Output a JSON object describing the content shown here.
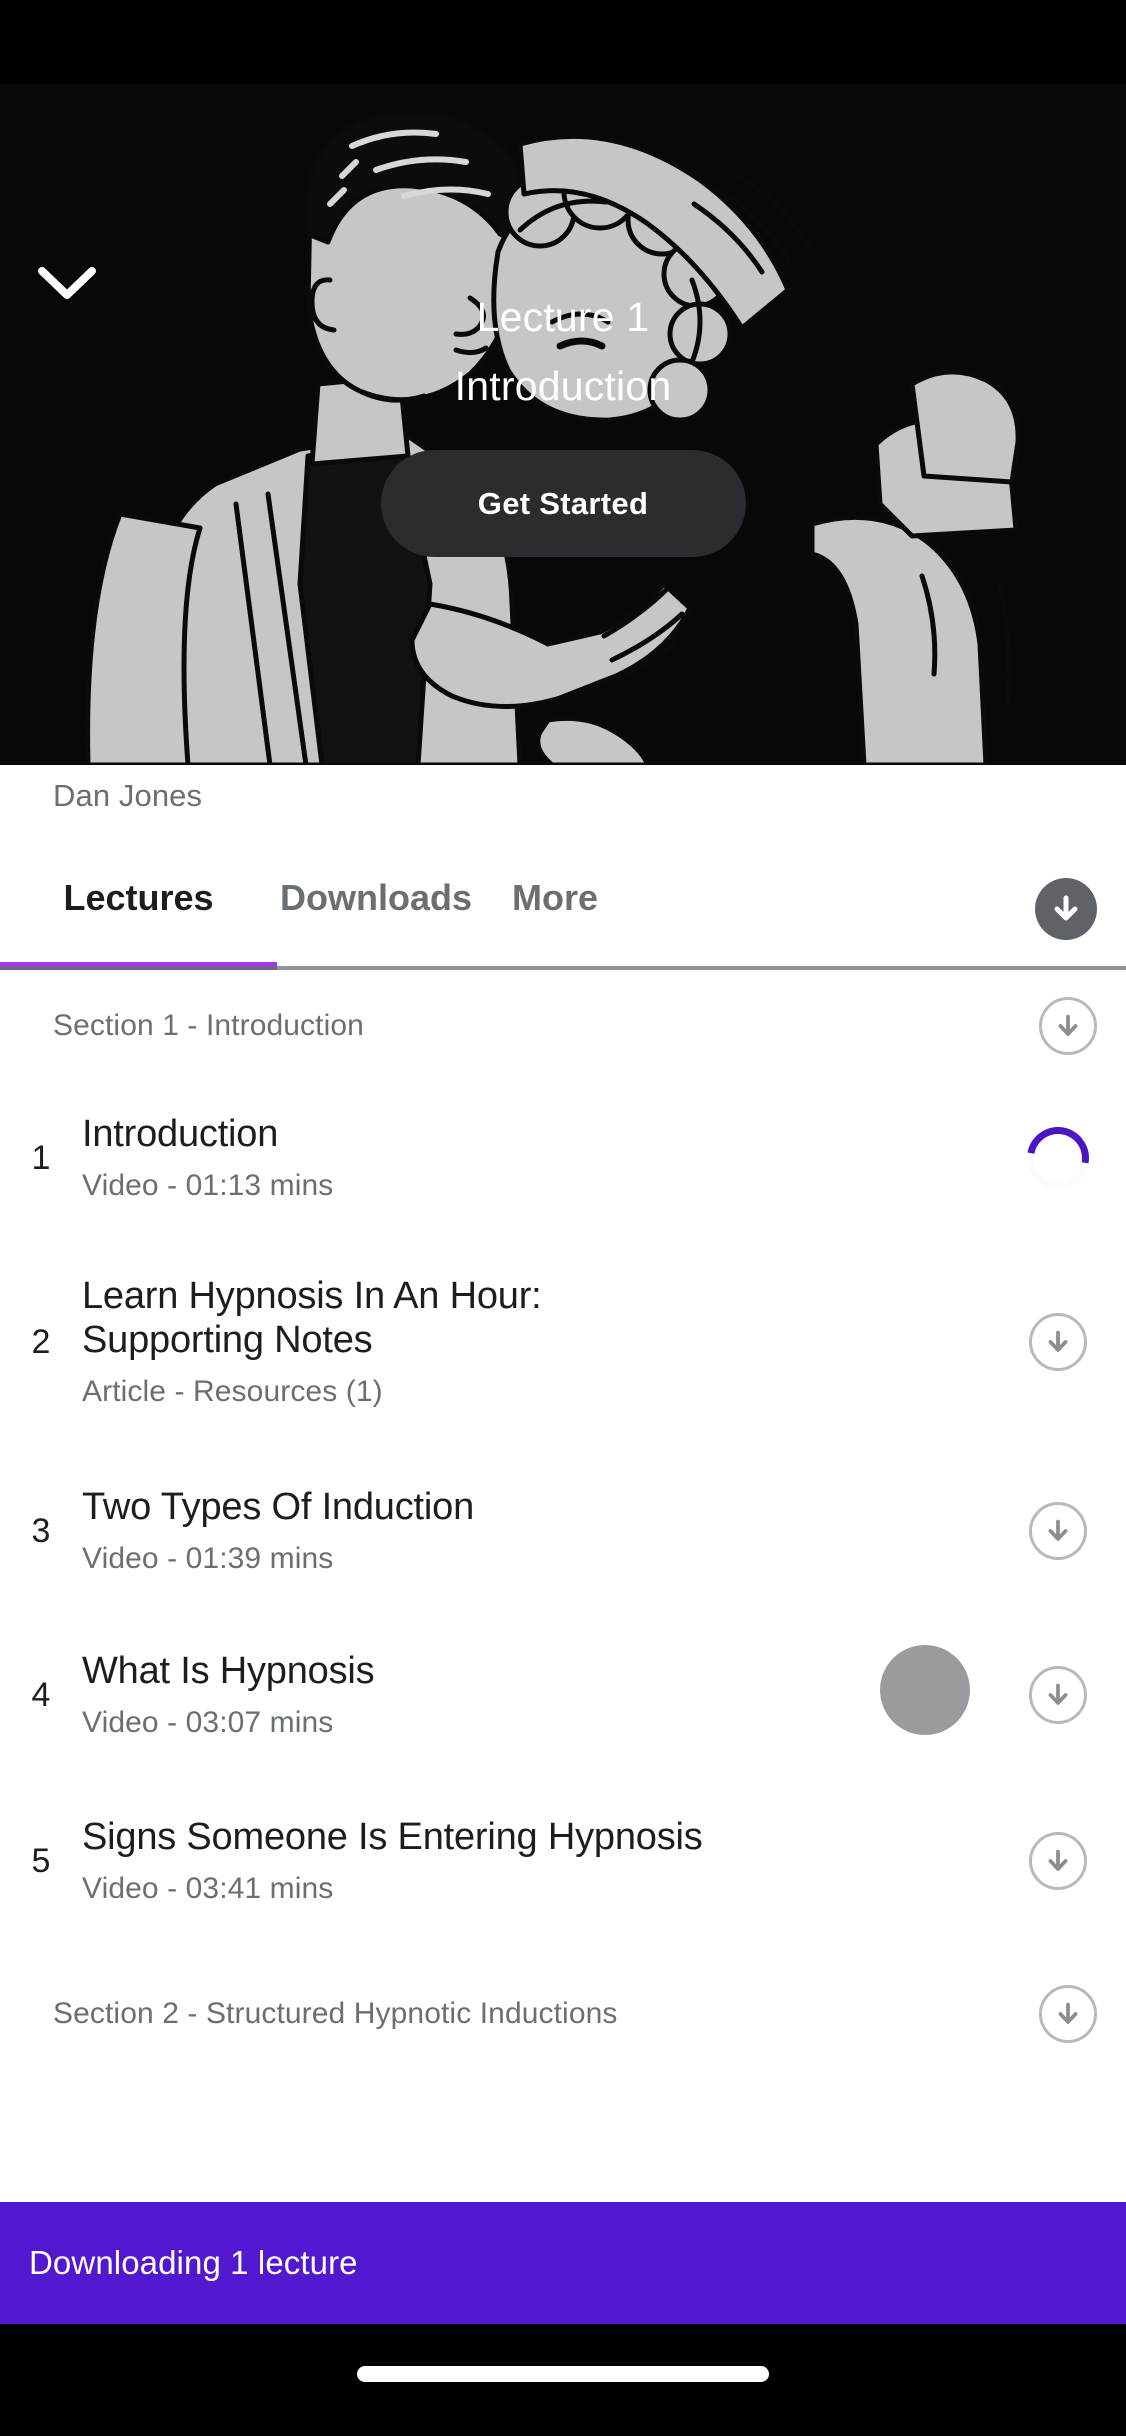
{
  "hero": {
    "back_icon": "chevron-down-icon",
    "title": "Lecture 1",
    "subtitle": "Introduction",
    "cta_label": "Get Started"
  },
  "instructor": {
    "name": "Dan Jones"
  },
  "tabs": {
    "items": [
      {
        "label": "Lectures",
        "active": true
      },
      {
        "label": "Downloads",
        "active": false
      },
      {
        "label": "More",
        "active": false
      }
    ],
    "download_all_icon": "download-arrow-circle-filled-icon"
  },
  "curriculum": {
    "sections": [
      {
        "label": "Section 1 - Introduction",
        "download_icon": "download-arrow-circle-icon",
        "lectures": [
          {
            "number": "1",
            "title": "Introduction",
            "meta": "Video - 01:13 mins",
            "state": "downloading",
            "icon": "download-progress-spinner-icon"
          },
          {
            "number": "2",
            "title": "Learn Hypnosis In An Hour: Supporting Notes",
            "meta": "Article - Resources (1)",
            "state": "idle",
            "icon": "download-arrow-circle-icon"
          },
          {
            "number": "3",
            "title": "Two Types Of Induction",
            "meta": "Video - 01:39 mins",
            "state": "idle",
            "icon": "download-arrow-circle-icon"
          },
          {
            "number": "4",
            "title": "What Is Hypnosis",
            "meta": "Video - 03:07 mins",
            "state": "idle",
            "icon": "download-arrow-circle-icon"
          },
          {
            "number": "5",
            "title": "Signs Someone Is Entering Hypnosis",
            "meta": "Video - 03:41 mins",
            "state": "idle",
            "icon": "download-arrow-circle-icon"
          }
        ]
      },
      {
        "label": "Section 2 - Structured Hypnotic Inductions",
        "download_icon": "download-arrow-circle-icon",
        "lectures": []
      }
    ]
  },
  "banner": {
    "text": "Downloading 1 lecture"
  },
  "colors": {
    "accent_purple": "#a435f0",
    "banner_purple": "#5118cf",
    "progress_purple": "#4b17c4",
    "text_primary": "#1c1d1f",
    "text_muted": "#6a6f73",
    "icon_outline": "#b7b9bd",
    "icon_filled": "#5f6368",
    "touch_dot": "#9b9b9f"
  }
}
